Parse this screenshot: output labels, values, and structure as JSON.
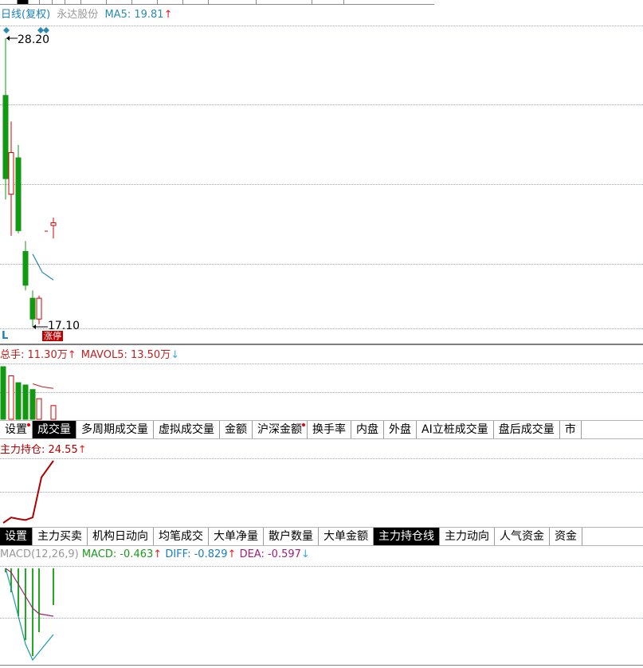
{
  "main_panel": {
    "title": "日线(复权)",
    "stock_name": "永达股份",
    "ma_label": "MA5: 19.81",
    "ma_arrow": "↑",
    "high_label": "28.20",
    "low_label": "17.10",
    "badge": "涨停",
    "corner_letter": "L"
  },
  "volume_panel": {
    "total_label": "总手: 11.30万",
    "total_arrow": "↑",
    "mavol_label": "MAVOL5: 13.50万",
    "mavol_arrow": "↓"
  },
  "volume_tabs": [
    {
      "label": "设置",
      "dot": true,
      "active": false
    },
    {
      "label": "成交量",
      "dot": false,
      "active": true
    },
    {
      "label": "多周期成交量",
      "dot": false,
      "active": false
    },
    {
      "label": "虚拟成交量",
      "dot": false,
      "active": false
    },
    {
      "label": "金额",
      "dot": false,
      "active": false
    },
    {
      "label": "沪深金额",
      "dot": true,
      "active": false
    },
    {
      "label": "换手率",
      "dot": false,
      "active": false
    },
    {
      "label": "内盘",
      "dot": false,
      "active": false
    },
    {
      "label": "外盘",
      "dot": false,
      "active": false
    },
    {
      "label": "AI立桩成交量",
      "dot": false,
      "active": false
    },
    {
      "label": "盘后成交量",
      "dot": false,
      "active": false
    },
    {
      "label": "市",
      "dot": false,
      "active": false
    }
  ],
  "position_panel": {
    "title": "主力持仓: 24.55",
    "arrow": "↑"
  },
  "position_tabs": [
    {
      "label": "设置",
      "active": true
    },
    {
      "label": "主力买卖",
      "active": false
    },
    {
      "label": "机构日动向",
      "active": false
    },
    {
      "label": "均笔成交",
      "active": false
    },
    {
      "label": "大单净量",
      "active": false
    },
    {
      "label": "散户数量",
      "active": false
    },
    {
      "label": "大单金额",
      "active": false
    },
    {
      "label": "主力持仓线",
      "active": true
    },
    {
      "label": "主力动向",
      "active": false
    },
    {
      "label": "人气资金",
      "active": false
    },
    {
      "label": "资金",
      "active": false
    }
  ],
  "macd_panel": {
    "params": "MACD(12,26,9)",
    "macd": "MACD: -0.463",
    "macd_arrow": "↑",
    "diff": "DIFF: -0.829",
    "diff_arrow": "↑",
    "dea": "DEA: -0.597",
    "dea_arrow": "↓"
  },
  "colors": {
    "up": "#d40000",
    "down": "#119911",
    "ma": "#2a8ab0",
    "title_blue": "#1a7fc0",
    "dea": "#a0207a",
    "arrow_red": "#e02020",
    "arrow_blue": "#36a9e8"
  },
  "chart_data": [
    {
      "type": "candlestick",
      "candles": [
        {
          "open": 26.0,
          "high": 28.2,
          "low": 22.0,
          "close": 22.8
        },
        {
          "open": 22.2,
          "high": 25.0,
          "low": 20.6,
          "close": 23.8
        },
        {
          "open": 23.6,
          "high": 24.1,
          "low": 20.7,
          "close": 20.8
        },
        {
          "open": 20.0,
          "high": 20.4,
          "low": 18.5,
          "close": 18.7
        },
        {
          "open": 18.2,
          "high": 18.5,
          "low": 17.1,
          "close": 17.4
        },
        {
          "open": 17.4,
          "high": 18.3,
          "low": 17.2,
          "close": 18.2
        },
        {
          "open": 21.0,
          "high": 21.3,
          "low": 20.5,
          "close": 21.1
        }
      ],
      "ma5": [
        19.9,
        19.2,
        18.9
      ]
    },
    {
      "type": "bar",
      "volumes": [
        23,
        19,
        16,
        15,
        13,
        9,
        6
      ],
      "mavol5": [
        15.5,
        14.2,
        13.5
      ]
    },
    {
      "type": "line",
      "values": [
        7.5,
        9.0,
        8.6,
        8.3,
        9.0,
        20.0,
        24.55
      ]
    },
    {
      "type": "bar",
      "macd": [
        -0.05,
        -0.3,
        -0.6,
        -0.9,
        -1.1,
        -0.8,
        -0.46
      ],
      "diff": [
        0.0,
        -0.25,
        -0.6,
        -0.95,
        -1.15,
        -1.05,
        -0.83
      ],
      "dea": [
        0.0,
        -0.05,
        -0.2,
        -0.35,
        -0.5,
        -0.57,
        -0.6
      ]
    }
  ]
}
